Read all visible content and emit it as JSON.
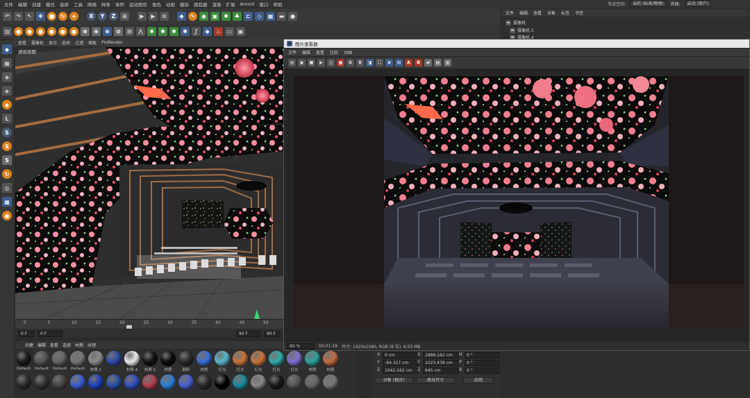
{
  "menu": [
    "文件",
    "编辑",
    "创建",
    "模式",
    "选择",
    "工具",
    "网格",
    "样条",
    "体积",
    "运动图形",
    "角色",
    "动画",
    "模拟",
    "跟踪器",
    "渲染",
    "扩展",
    "Arnold",
    "窗口",
    "帮助"
  ],
  "right_menu": {
    "node_label": "节点空间:",
    "node_value": "当前 (标准/物理)",
    "layout_label": "界面:",
    "layout_value": "启动 (用户)"
  },
  "viewport": {
    "menu": [
      "查看",
      "摄像机",
      "显示",
      "选项",
      "过滤",
      "面板",
      "ProRender"
    ],
    "label": "透视视图"
  },
  "timeline": {
    "ticks": [
      "0",
      "5",
      "10",
      "15",
      "20",
      "25",
      "30",
      "35",
      "40",
      "45",
      "50"
    ],
    "start": "0 F",
    "end": "90 F"
  },
  "material_menu": [
    "创建",
    "编辑",
    "查看",
    "选择",
    "材质",
    "纹理"
  ],
  "materials_row1": [
    "Default",
    "Default",
    "Default",
    "Default",
    "材质.1",
    "",
    "材质.4",
    "材质.5",
    "材质",
    "颜料",
    "材质",
    "灯光",
    "灯光",
    "灯光",
    "灯光",
    "灯光",
    "材质",
    "材质"
  ],
  "materials_row2": [
    "",
    "",
    "",
    "",
    "",
    "",
    "",
    "",
    "",
    "",
    "",
    "",
    "",
    "",
    "",
    "",
    "",
    ""
  ],
  "coords": {
    "rows": [
      {
        "a": "X",
        "av": "0 cm",
        "b": "X",
        "bv": "2886.162 cm",
        "c": "H",
        "cv": "0 °"
      },
      {
        "a": "Y",
        "av": "-94.327 cm",
        "b": "Y",
        "bv": "1023.478 cm",
        "c": "P",
        "cv": "0 °"
      },
      {
        "a": "Z",
        "av": "1042.162 cm",
        "b": "Z",
        "bv": "645 cm",
        "c": "B",
        "cv": "0 °"
      }
    ],
    "mode": "对象 (相对)",
    "size_mode": "绝对尺寸",
    "apply": "应用"
  },
  "objects": {
    "menu": [
      "文件",
      "编辑",
      "查看",
      "对象",
      "标签",
      "书签"
    ],
    "items": [
      "摄像机",
      "摄像机.5",
      "摄像机.4"
    ]
  },
  "picture_viewer": {
    "title": "图片查看器",
    "menu": [
      "文件",
      "编辑",
      "查看",
      "比较",
      "动画"
    ],
    "zoom": "80 %",
    "time": "00:01:59",
    "info": "尺寸: 1920x1080, RGB (8 位), 6.03 MB"
  },
  "colors": {
    "accent": "#d9821e",
    "blue": "#3e5c8c",
    "bg": "#2b2b2b"
  }
}
